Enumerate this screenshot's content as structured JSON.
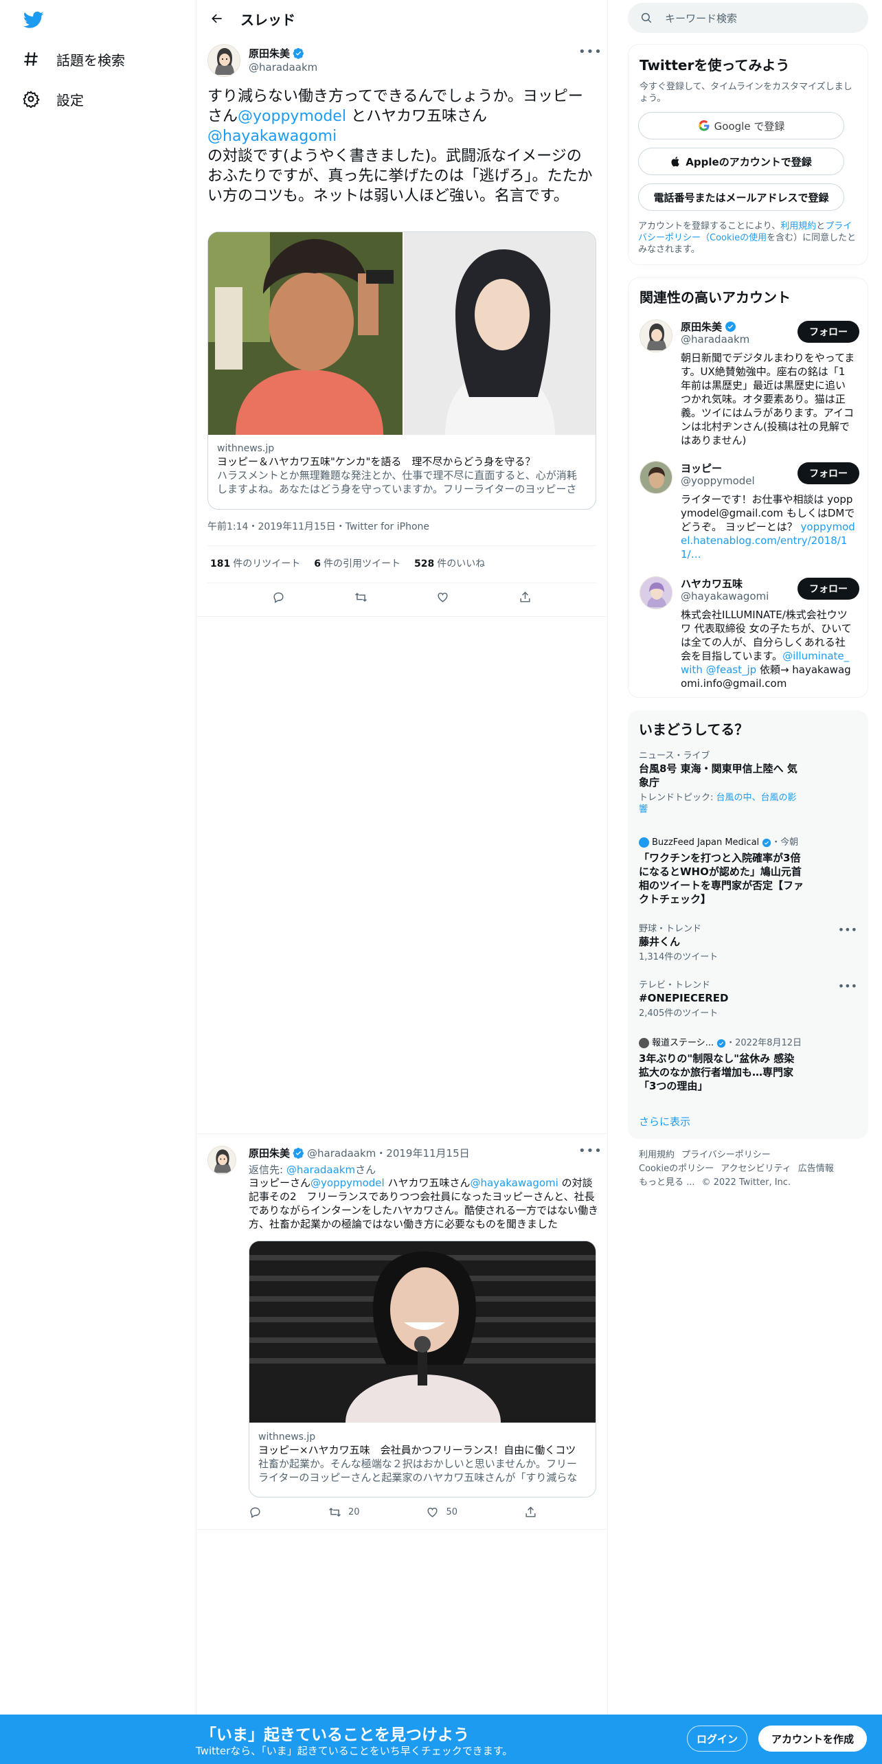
{
  "nav": {
    "explore_label": "話題を検索",
    "settings_label": "設定"
  },
  "header": {
    "title": "スレッド"
  },
  "tweet": {
    "author_name": "原田朱美",
    "author_handle": "@haradaakm",
    "text_1": "すり減らない働き方ってできるんでしょうか。ヨッピーさん",
    "mention_1": "@yoppymodel",
    "text_2": " とハヤカワ五味さん ",
    "mention_2": "@hayakawagomi",
    "text_3": " の対談です(ようやく書きました)。武闘派なイメージのおふたりですが、真っ先に挙げたのは「逃げろ」。たたかい方のコツも。ネットは弱い人ほど強い。名言です。",
    "card": {
      "domain": "withnews.jp",
      "title": "ヨッピー＆ハヤカワ五味\"ケンカ\"を語る　理不尽からどう身を守る？",
      "description": "ハラスメントとか無理難題な発注とか、仕事で理不尽に直面すると、心が消耗しますよね。あなたはどう身を守っていますか。フリーライターのヨッピーさん…"
    },
    "timestamp": "午前1:14・2019年11月15日・Twitter for iPhone",
    "retweets": "181",
    "retweets_label": "件のリツイート",
    "quotes": "6",
    "quotes_label": "件の引用ツイート",
    "likes": "528",
    "likes_label": "件のいいね"
  },
  "reply": {
    "author_name": "原田朱美",
    "author_handle": "@haradaakm",
    "date": "・2019年11月15日",
    "reply_to_prefix": "返信先: ",
    "reply_to_handle": "@haradaakm",
    "reply_to_suffix": "さん",
    "text_1": "ヨッピーさん",
    "mention_1": "@yoppymodel",
    "text_2": " ハヤカワ五味さん",
    "mention_2": "@hayakawagomi",
    "text_3": " の対談記事その2　フリーランスでありつつ会社員になったヨッピーさんと、社長でありながらインターンをしたハヤカワさん。酷使される一方ではない働き方、社畜か起業かの極論ではない働き方に必要なものを聞きました",
    "card": {
      "domain": "withnews.jp",
      "title": "ヨッピー×ハヤカワ五味　会社員かつフリーランス！自由に働くコツ",
      "description": "社畜か起業か。そんな極端な２択はおかしいと思いませんか。フリーライターのヨッピーさんと起業家のハヤカワ五味さんが「すり減らない…"
    },
    "retweet_count": "20",
    "like_count": "50"
  },
  "sidebar": {
    "search_placeholder": "キーワード検索",
    "signup": {
      "title": "Twitterを使ってみよう",
      "subtitle": "今すぐ登録して、タイムラインをカスタマイズしましょう。",
      "google": "Google で登録",
      "apple": "Appleのアカウントで登録",
      "phone": "電話番号またはメールアドレスで登録",
      "legal_1": "アカウントを登録することにより、",
      "legal_terms": "利用規約",
      "legal_2": "と",
      "legal_privacy": "プライバシーポリシー（Cookieの使用",
      "legal_3": "を含む）に同意したとみなされます。"
    },
    "relevant": {
      "title": "関連性の高いアカウント",
      "follow_label": "フォロー",
      "accounts": [
        {
          "name": "原田朱美",
          "handle": "@haradaakm",
          "bio": "朝日新聞でデジタルまわりをやってます。UX絶賛勉強中。座右の銘は「1年前は黒歴史」最近は黒歴史に追いつかれ気味。オタ要素あり。猫は正義。ツイにはムラがあります。アイコンは北村ヂンさん(投稿は社の見解ではありません)"
        },
        {
          "name": "ヨッピー",
          "handle": "@yoppymodel",
          "bio": "ライターです！お仕事や相談は yoppymodel@gmail.com もしくはDMでどうぞ。 ヨッピーとは？ ",
          "bio_link": "yoppymodel.hatenablog.com/entry/2018/11/…"
        },
        {
          "name": "ハヤカワ五味",
          "handle": "@hayakawagomi",
          "bio": "株式会社ILLUMINATE/株式会社ウツワ 代表取締役 女の子たちが、ひいては全ての人が、自分らしくあれる社会を目指しています。",
          "bio_link": "@illuminate_with @feast_jp",
          "bio_tail": " 依頼→ hayakawagomi.info@gmail.com"
        }
      ]
    },
    "trends": {
      "title": "いまどうしてる？",
      "items": [
        {
          "category": "ニュース・ライブ",
          "title": "台風8号 東海・関東甲信上陸へ 気象庁",
          "sub_prefix": "トレンドトピック: ",
          "sub_link": "台風の中、台風の影響"
        },
        {
          "category": "BuzzFeed Japan Medical",
          "category_suffix": "・今朝",
          "title": "「ワクチンを打つと入院確率が3倍になるとWHOが認めた」鳩山元首相のツイートを専門家が否定【ファクトチェック】"
        },
        {
          "category": "野球・トレンド",
          "title": "藤井くん",
          "sub": "1,314件のツイート"
        },
        {
          "category": "テレビ・トレンド",
          "title": "#ONEPIECERED",
          "sub": "2,405件のツイート"
        },
        {
          "category": "報道ステーシ...",
          "category_suffix": "・2022年8月12日",
          "title": "3年ぶりの\"制限なし\"盆休み 感染拡大のなか旅行者増加も…専門家「3つの理由」"
        }
      ],
      "more": "さらに表示"
    },
    "footer": {
      "l1": "利用規約",
      "l2": "プライバシーポリシー",
      "l3": "Cookieのポリシー",
      "l4": "アクセシビリティ",
      "l5": "広告情報",
      "l6": "もっと見る ...",
      "l7": "© 2022 Twitter, Inc."
    }
  },
  "bottom": {
    "headline": "「いま」起きていることを見つけよう",
    "subline": "Twitterなら、「いま」起きていることをいち早くチェックできます。",
    "login": "ログイン",
    "signup": "アカウントを作成"
  },
  "colors": {
    "accent": "#1d9bf0",
    "text": "#0f1419",
    "muted": "#536471"
  }
}
